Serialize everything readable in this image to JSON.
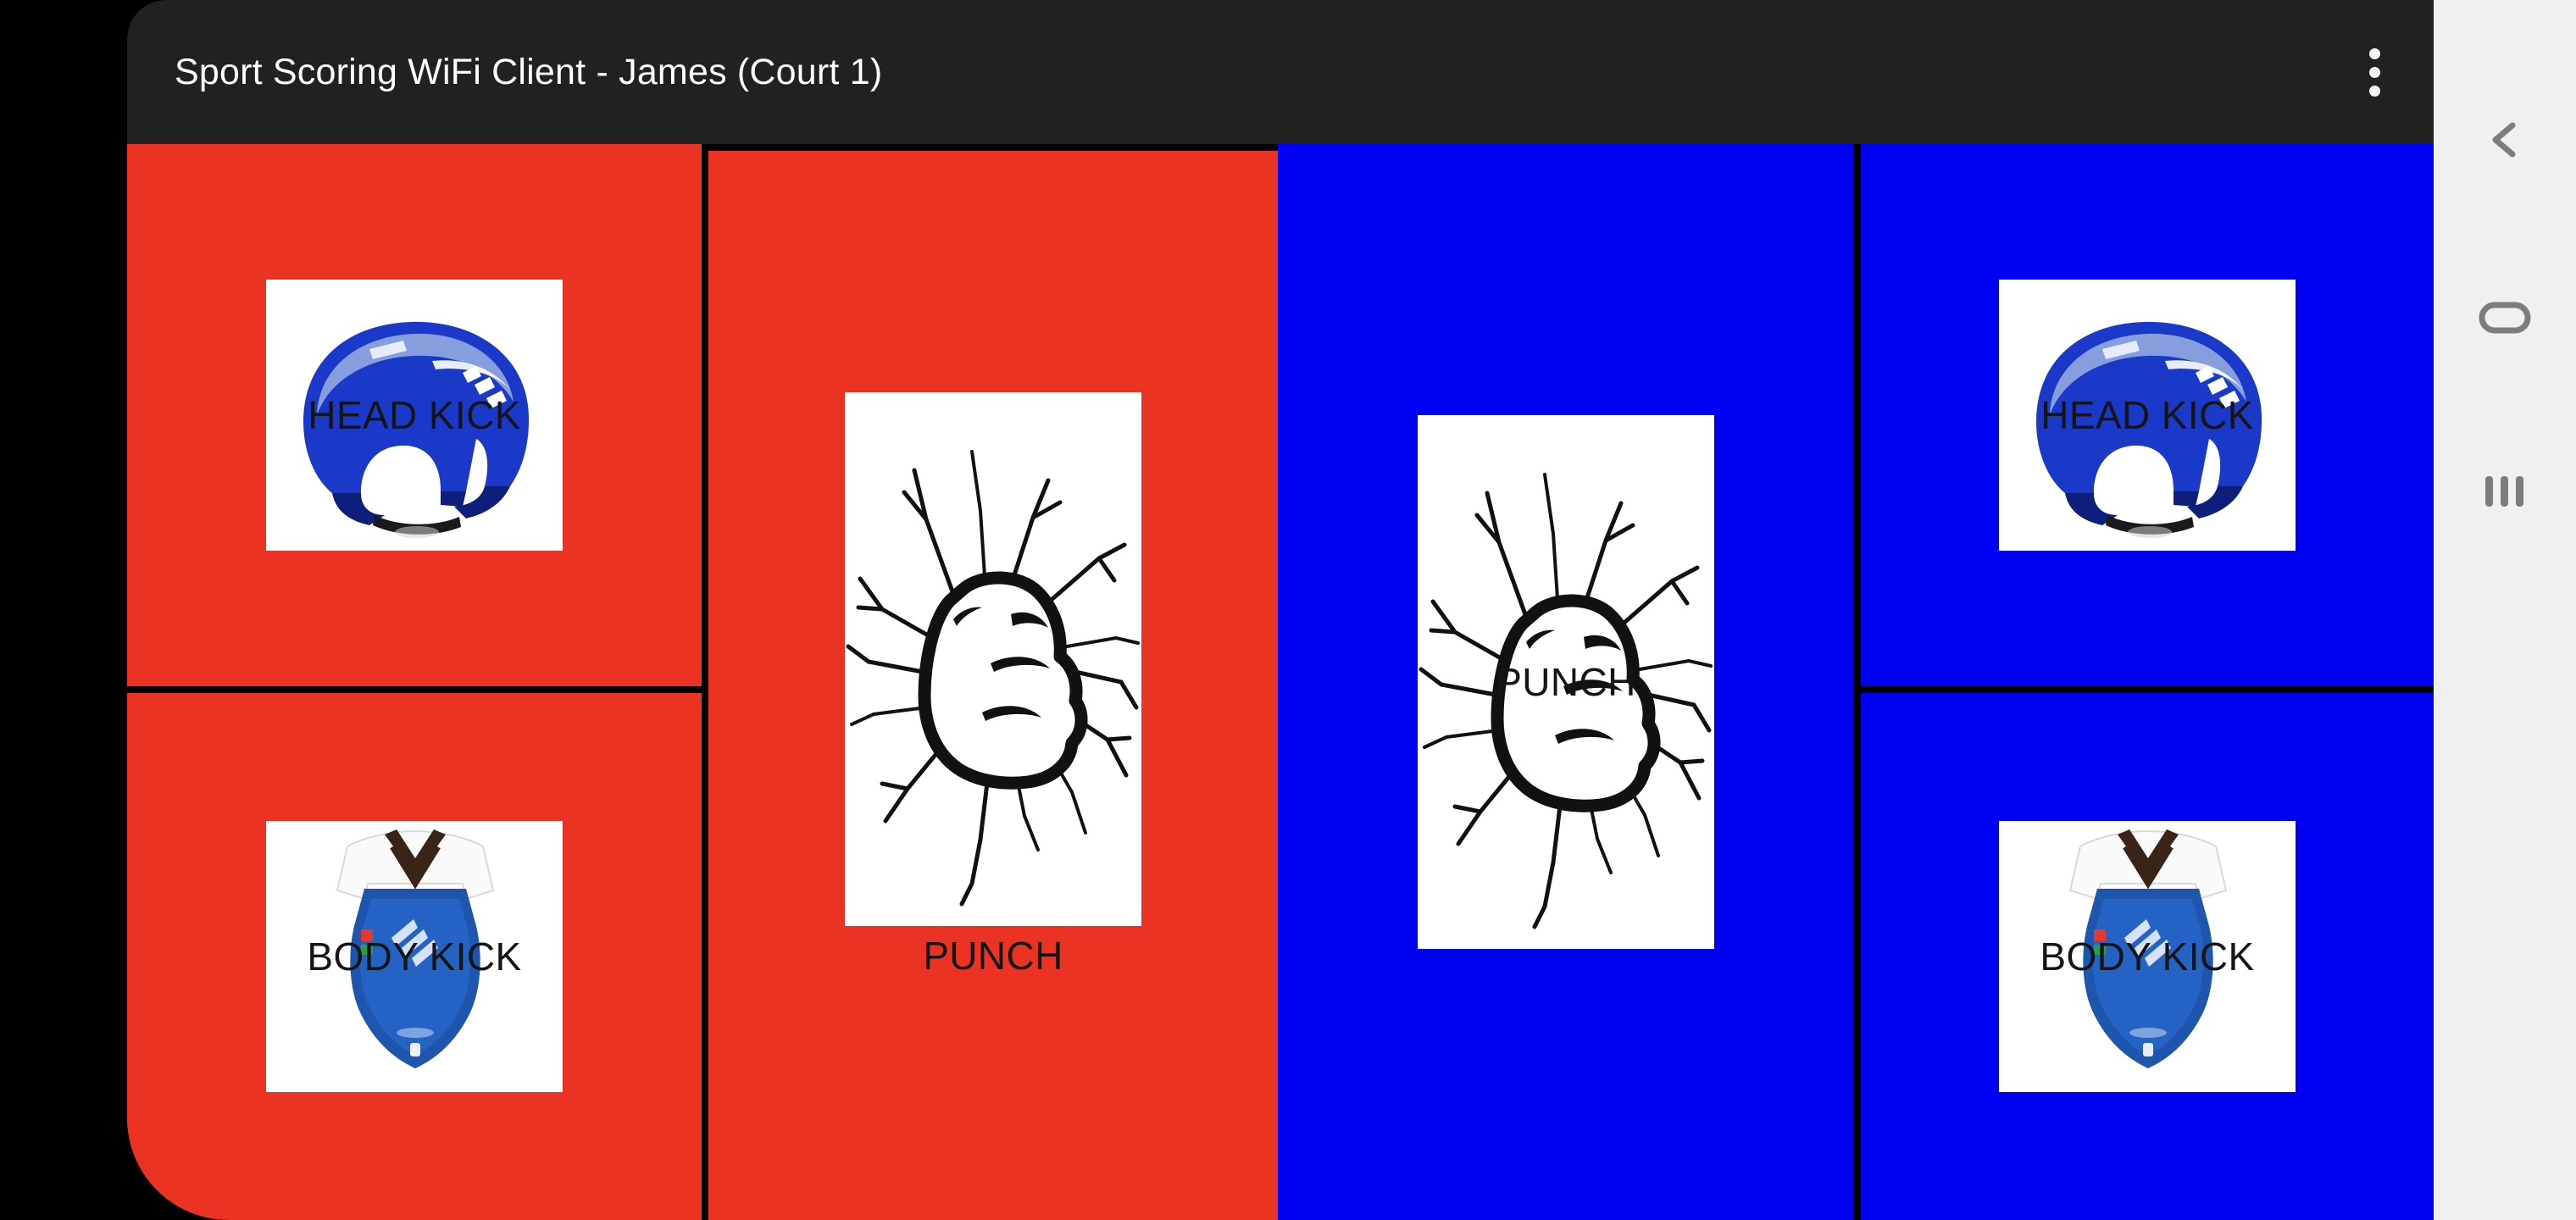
{
  "app": {
    "title": "Sport Scoring WiFi Client  -  James  (Court 1)",
    "app_name": "Sport Scoring WiFi Client",
    "athlete": "James",
    "court": "Court 1",
    "overflow_menu_icon": "more-vert-icon",
    "bar_color": "#212121",
    "title_color": "#ffffff"
  },
  "colors": {
    "red": "#ea3323",
    "blue": "#0000f2",
    "divider": "#000000",
    "tile_background": "#ffffff",
    "nav_bar_background": "#f0f0f0",
    "nav_icon": "#808080"
  },
  "scoring": {
    "red_side": {
      "color_name": "red",
      "color": "#ea3323",
      "buttons": [
        {
          "id": "red-head-kick",
          "label": "HEAD KICK",
          "icon": "headguard-icon",
          "caption_position": "overlay"
        },
        {
          "id": "red-body-kick",
          "label": "BODY KICK",
          "icon": "chest-protector-icon",
          "caption_position": "overlay"
        },
        {
          "id": "red-punch",
          "label": "PUNCH",
          "icon": "fist-through-wall-icon",
          "caption_position": "below"
        }
      ]
    },
    "blue_side": {
      "color_name": "blue",
      "color": "#0000f2",
      "buttons": [
        {
          "id": "blue-punch",
          "label": "PUNCH",
          "icon": "fist-through-wall-icon",
          "caption_position": "overlay"
        },
        {
          "id": "blue-head-kick",
          "label": "HEAD KICK",
          "icon": "headguard-icon",
          "caption_position": "overlay"
        },
        {
          "id": "blue-body-kick",
          "label": "BODY KICK",
          "icon": "chest-protector-icon",
          "caption_position": "overlay"
        }
      ]
    }
  },
  "system_nav": {
    "buttons": [
      {
        "id": "back",
        "label": "Back",
        "icon": "chevron-left-icon"
      },
      {
        "id": "home",
        "label": "Home",
        "icon": "home-rounded-rect-icon"
      },
      {
        "id": "recents",
        "label": "Recents",
        "icon": "recents-bars-icon"
      }
    ]
  }
}
